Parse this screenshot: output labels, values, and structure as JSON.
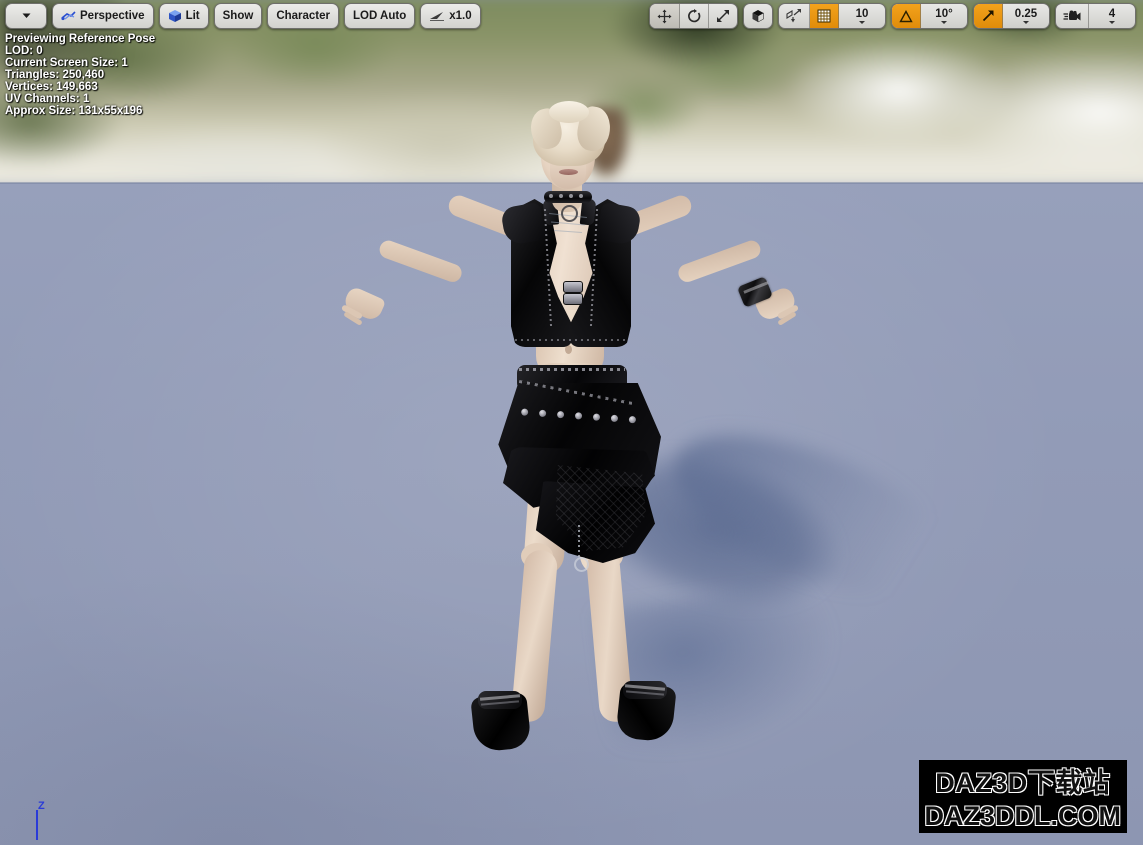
{
  "app": {
    "title": "Unreal Engine Skeletal Mesh Viewport"
  },
  "toolbar_left": {
    "viewport_menu": {
      "label": "",
      "icon": "chevron-down-icon"
    },
    "view_mode": {
      "label": "Perspective",
      "icon": "perspective-camera-icon"
    },
    "lighting_mode": {
      "label": "Lit",
      "icon": "lit-cube-icon"
    },
    "show": {
      "label": "Show"
    },
    "character": {
      "label": "Character"
    },
    "lod": {
      "label": "LOD Auto"
    },
    "playback_speed": {
      "label": "x1.0",
      "icon": "playback-speed-icon"
    }
  },
  "toolbar_right": {
    "transform_modes": [
      {
        "name": "translate",
        "icon": "move-arrows-icon",
        "active": true
      },
      {
        "name": "rotate",
        "icon": "rotate-arc-icon",
        "active": false
      },
      {
        "name": "scale",
        "icon": "scale-arrows-icon",
        "active": false
      }
    ],
    "coordinate_system": {
      "icon": "world-cube-icon",
      "active": false
    },
    "surface_snap": {
      "icon": "surface-snap-icon",
      "active": false
    },
    "grid_snap": {
      "icon": "grid-icon",
      "enabled": true,
      "value": "10"
    },
    "angle_snap": {
      "icon": "angle-triangle-icon",
      "enabled": true,
      "value": "10°"
    },
    "scale_snap": {
      "icon": "scale-snap-arrow-icon",
      "enabled": true,
      "value": "0.25"
    },
    "camera_speed": {
      "icon": "camera-speed-icon",
      "value": "4"
    }
  },
  "stats_overlay": {
    "lines": [
      "Previewing Reference Pose",
      "LOD: 0",
      "Current Screen Size: 1",
      "Triangles: 250,460",
      "Vertices: 149,663",
      "UV Channels: 1",
      "Approx Size: 131x55x196"
    ]
  },
  "axis_gizmo": {
    "z_label": "Z",
    "z_color": "#2a3bd8"
  },
  "watermark": {
    "line1": "DAZ3D下载站",
    "line2": "DAZ3DDL.COM"
  },
  "colors": {
    "accent_orange": "#f3a21c",
    "floor": "#929bb7",
    "button_face": "#e2e2de",
    "overlay_text": "#ffffff"
  },
  "scene": {
    "subject": "female-character-a-pose",
    "description": "Blonde short-haired female 3D character in A-pose wearing black cropped vest, black ruffled skirt, choker, wrist cuff and black boots"
  }
}
